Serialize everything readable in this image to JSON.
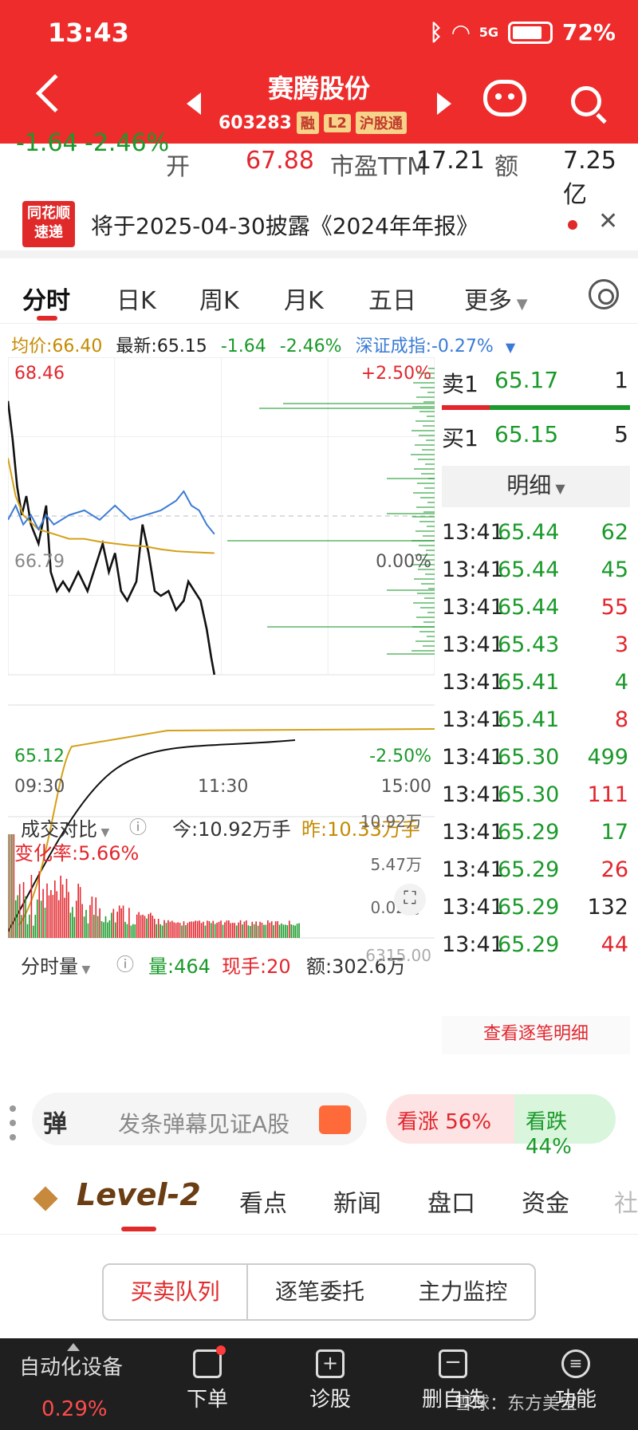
{
  "status_bar": {
    "time": "13:43",
    "battery": "72%",
    "signal": "5G"
  },
  "header": {
    "title": "赛腾股份",
    "code": "603283",
    "tags": [
      "融",
      "L2",
      "沪股通"
    ]
  },
  "quote": {
    "change": "-1.64",
    "change_pct": "-2.46%",
    "open_label": "开",
    "open_value": "67.88",
    "pe_label": "市盈TTM",
    "pe_value": "17.21",
    "amount_label": "额",
    "amount_value": "7.25亿"
  },
  "notice": {
    "logo_line1": "同花顺",
    "logo_line2": "速递",
    "text": "将于2025-04-30披露《2024年年报》"
  },
  "tabs": [
    "分时",
    "日K",
    "周K",
    "月K",
    "五日",
    "更多"
  ],
  "avg_row": {
    "avg": "均价:66.40",
    "latest": "最新:65.15",
    "change": "-1.64",
    "pct": "-2.46%",
    "index": "深证成指:-0.27%"
  },
  "chart_labels": {
    "y_top": "68.46",
    "y_mid": "66.79",
    "y_bottom": "65.12",
    "pct_top": "+2.50%",
    "pct_mid": "0.00%",
    "pct_bottom": "-2.50%",
    "x": [
      "09:30",
      "11:30",
      "15:00"
    ],
    "compare_title": "成交对比",
    "today": "今:10.92万手",
    "yesterday": "昨:10.33万手",
    "change_rate": "变化率:5.66%",
    "vol_axis": [
      "10.92万",
      "5.47万",
      "0.02万"
    ],
    "volume_title": "分时量",
    "volume": "量:464",
    "current_hand": "现手:20",
    "amount": "额:302.6万",
    "vol_axis_top": "6315.00"
  },
  "order_book": {
    "ask_label": "卖1",
    "ask_price": "65.17",
    "ask_qty": "1",
    "bid_label": "买1",
    "bid_price": "65.15",
    "bid_qty": "5"
  },
  "detail": {
    "title": "明细",
    "rows": [
      {
        "time": "13:41",
        "price": "65.44",
        "qty": "62",
        "dir": "green"
      },
      {
        "time": "13:41",
        "price": "65.44",
        "qty": "45",
        "dir": "green"
      },
      {
        "time": "13:41",
        "price": "65.44",
        "qty": "55",
        "dir": "red"
      },
      {
        "time": "13:41",
        "price": "65.43",
        "qty": "3",
        "dir": "red"
      },
      {
        "time": "13:41",
        "price": "65.41",
        "qty": "4",
        "dir": "green"
      },
      {
        "time": "13:41",
        "price": "65.41",
        "qty": "8",
        "dir": "red"
      },
      {
        "time": "13:41",
        "price": "65.30",
        "qty": "499",
        "dir": "green"
      },
      {
        "time": "13:41",
        "price": "65.30",
        "qty": "111",
        "dir": "red"
      },
      {
        "time": "13:41",
        "price": "65.29",
        "qty": "17",
        "dir": "green"
      },
      {
        "time": "13:41",
        "price": "65.29",
        "qty": "26",
        "dir": "red"
      },
      {
        "time": "13:41",
        "price": "65.29",
        "qty": "132",
        "dir": "dark"
      },
      {
        "time": "13:41",
        "price": "65.29",
        "qty": "44",
        "dir": "red"
      }
    ],
    "more": "查看逐笔明细"
  },
  "danmu": {
    "icon_text": "弹",
    "placeholder": "发条弹幕见证A股",
    "rise": "看涨 56%",
    "fall": "看跌 44%",
    "rise_fraction": 0.56
  },
  "level2": {
    "logo": "Level-2",
    "tabs": [
      "看点",
      "新闻",
      "盘口",
      "资金",
      "社"
    ]
  },
  "subtabs": [
    "买卖队列",
    "逐笔委托",
    "主力监控"
  ],
  "bottom": {
    "sector": "自动化设备",
    "sector_pct": "0.29%",
    "items": [
      "下单",
      "诊股",
      "删自选",
      "功能"
    ],
    "watermark": "雪球：东方美宝"
  },
  "colors": {
    "up": "#e3262d",
    "down": "#1a9a2a",
    "header": "#ee2c2c",
    "avg_line": "#d4a017",
    "index_line": "#3a7bd5"
  },
  "chart_data": {
    "type": "line",
    "x_range": [
      "09:30",
      "15:00"
    ],
    "ylim": [
      65.12,
      68.46
    ],
    "pct_range": [
      "-2.50%",
      "+2.50%"
    ],
    "series": [
      {
        "points": [
          [
            0,
            68.0
          ],
          [
            3,
            67.6
          ],
          [
            6,
            67.1
          ],
          [
            9,
            66.8
          ],
          [
            12,
            67.0
          ],
          [
            15,
            66.7
          ],
          [
            20,
            66.5
          ],
          [
            25,
            66.9
          ],
          [
            28,
            66.2
          ],
          [
            32,
            66.0
          ],
          [
            36,
            66.1
          ],
          [
            40,
            66.0
          ],
          [
            46,
            66.2
          ],
          [
            52,
            66.0
          ],
          [
            58,
            66.3
          ],
          [
            62,
            66.5
          ],
          [
            66,
            66.2
          ],
          [
            70,
            66.4
          ],
          [
            74,
            66.0
          ],
          [
            78,
            65.9
          ],
          [
            84,
            66.1
          ],
          [
            88,
            66.7
          ],
          [
            92,
            66.4
          ],
          [
            96,
            66.0
          ],
          [
            100,
            65.95
          ],
          [
            105,
            66.0
          ],
          [
            110,
            65.8
          ],
          [
            115,
            65.9
          ],
          [
            118,
            66.1
          ],
          [
            122,
            66.0
          ],
          [
            126,
            65.9
          ],
          [
            130,
            65.6
          ],
          [
            133,
            65.3
          ],
          [
            135,
            65.12
          ]
        ]
      },
      {
        "points": [
          [
            0,
            67.4
          ],
          [
            5,
            67.0
          ],
          [
            10,
            66.8
          ],
          [
            20,
            66.65
          ],
          [
            30,
            66.6
          ],
          [
            40,
            66.55
          ],
          [
            50,
            66.55
          ],
          [
            60,
            66.52
          ],
          [
            70,
            66.5
          ],
          [
            80,
            66.48
          ],
          [
            90,
            66.47
          ],
          [
            100,
            66.44
          ],
          [
            110,
            66.42
          ],
          [
            120,
            66.41
          ],
          [
            135,
            66.4
          ]
        ]
      },
      {
        "points": [
          [
            0,
            66.75
          ],
          [
            5,
            66.9
          ],
          [
            10,
            66.7
          ],
          [
            15,
            66.8
          ],
          [
            20,
            66.65
          ],
          [
            25,
            66.8
          ],
          [
            30,
            66.7
          ],
          [
            40,
            66.8
          ],
          [
            50,
            66.85
          ],
          [
            60,
            66.75
          ],
          [
            70,
            66.9
          ],
          [
            80,
            66.75
          ],
          [
            90,
            66.8
          ],
          [
            100,
            66.85
          ],
          [
            110,
            66.95
          ],
          [
            115,
            67.05
          ],
          [
            120,
            66.9
          ],
          [
            125,
            66.85
          ],
          [
            130,
            66.7
          ],
          [
            135,
            66.6
          ]
        ]
      }
    ]
  }
}
